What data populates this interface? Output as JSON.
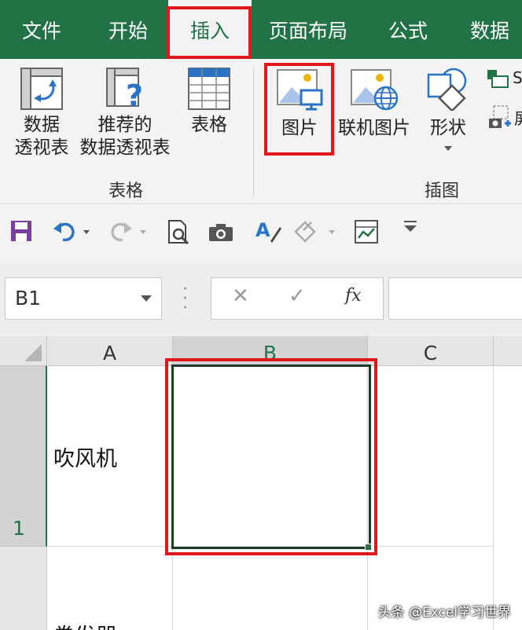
{
  "tabs": {
    "file": "文件",
    "home": "开始",
    "insert": "插入",
    "layout": "页面布局",
    "formula": "公式",
    "data": "数据"
  },
  "ribbon": {
    "pivot_table_line1": "数据",
    "pivot_table_line2": "透视表",
    "recommended_pivot_line1": "推荐的",
    "recommended_pivot_line2": "数据透视表",
    "table": "表格",
    "group_tables": "表格",
    "picture": "图片",
    "online_picture": "联机图片",
    "shapes": "形状",
    "group_illustrations": "插图",
    "smartart_partial": "S",
    "screenshot_partial": "屏"
  },
  "name_box": {
    "value": "B1"
  },
  "formula_bar": {
    "cancel_symbol": "✕",
    "enter_symbol": "✓",
    "fx_label": "fx",
    "value": ""
  },
  "grid": {
    "columns": [
      "A",
      "B",
      "C"
    ],
    "rows": [
      "1"
    ],
    "cells": {
      "A1": "吹风机",
      "B1": "",
      "A2_partial": "卷发器"
    }
  },
  "watermark": "头条 @Excel学习世界",
  "colors": {
    "excel_green": "#217346",
    "highlight_red": "#e0181b",
    "ribbon_bg": "#f3f3f3"
  },
  "highlights": [
    "tab-insert",
    "picture-button",
    "cell-B1"
  ]
}
